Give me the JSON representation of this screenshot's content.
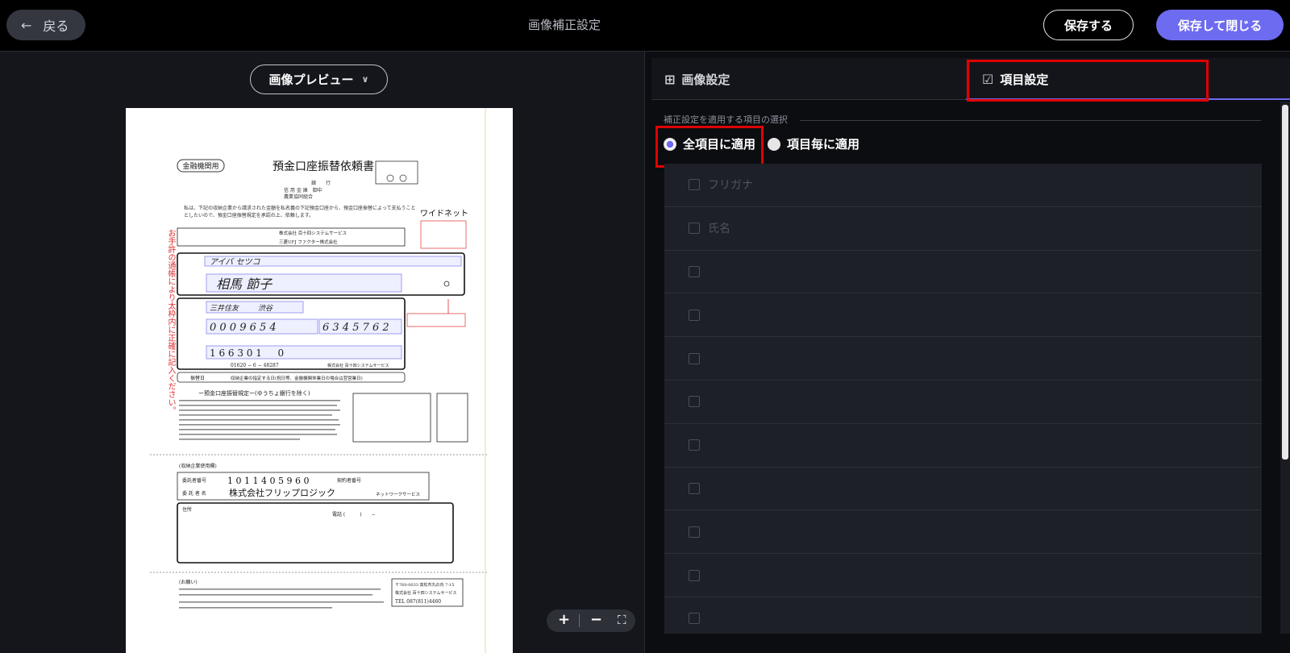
{
  "header": {
    "back_label": "戻る",
    "title": "画像補正設定",
    "save_label": "保存する",
    "save_close_label": "保存して閉じる"
  },
  "preview": {
    "dropdown_label": "画像プレビュー",
    "zoom_in": "+",
    "zoom_out": "−",
    "fit": "⛶",
    "document": {
      "org_label": "金融機関用",
      "doc_title": "預金口座振替依頼書",
      "widenet": "ワイドネット",
      "header_lines": [
        "銀　　行",
        "信 用 金 庫　御中",
        "農業協同組合"
      ],
      "intro": "私は、下記の収納企業から請求された金額を私名義の下記預金口座から、預金口座振替によって支払うこととしたいので、預金口座振替規定を承認の上、依頼します。",
      "side_note": "お手許の通帳により太枠内に正確に記入ください。",
      "collectors": [
        "株式会社 百十四システムサービス",
        "三菱UFJ ファクター株式会社"
      ],
      "furigana_handwritten": "アイバ セツコ",
      "name_handwritten": "相馬 節子",
      "bank_hand": "三井住友",
      "branch_hand": "渋谷",
      "bank_code_digits": "0 0 0 9 6 5 4",
      "account_digits": "6 3 4 5 7 6 2",
      "customer_digits": "1 6 6 3 0 1 　 0",
      "postal_account": "01620 − 6 − 48287",
      "postal_company": "株式会社 百十四システムサービス",
      "start_date_label": "振替日",
      "start_date_text": "収納企業の指定する日(祝日等、金融機関休業日の場合は翌営業日)",
      "yucho_title": "ー預金口座振替規定ー(ゆうちょ銀行を除く)",
      "company_use": "(収納企業使用欄)",
      "consignor_no_label": "委託者番号",
      "consignor_no": "1 0 1 1 4 0 5 9 6 0",
      "contract_no_label": "契約者番号",
      "consignor_name_label": "委 託 者 名",
      "consignor_name": "株式会社フリップロジック",
      "service_name": "ネットワークサービス",
      "address_label": "住所",
      "phone_label": "電話 (　　　)　　−",
      "notice_label": "(お願い)",
      "footer_address": "〒760-0033 高松市丸の内 7-15",
      "footer_company": "株式会社 百十四システムサービス",
      "footer_tel": "TEL 087(811)4460"
    }
  },
  "settings": {
    "tabs": [
      {
        "label": "画像設定",
        "icon": "image-plus-icon"
      },
      {
        "label": "項目設定",
        "icon": "checklist-icon"
      }
    ],
    "section_label": "補正設定を適用する項目の選択",
    "radio_all": "全項目に適用",
    "radio_each": "項目毎に適用",
    "items": [
      {
        "label": "フリガナ"
      },
      {
        "label": "氏名"
      },
      {
        "label": ""
      },
      {
        "label": ""
      },
      {
        "label": ""
      },
      {
        "label": ""
      },
      {
        "label": ""
      },
      {
        "label": ""
      },
      {
        "label": ""
      },
      {
        "label": ""
      },
      {
        "label": ""
      }
    ]
  },
  "colors": {
    "accent": "#6d6bf0",
    "highlight": "#e00000"
  }
}
